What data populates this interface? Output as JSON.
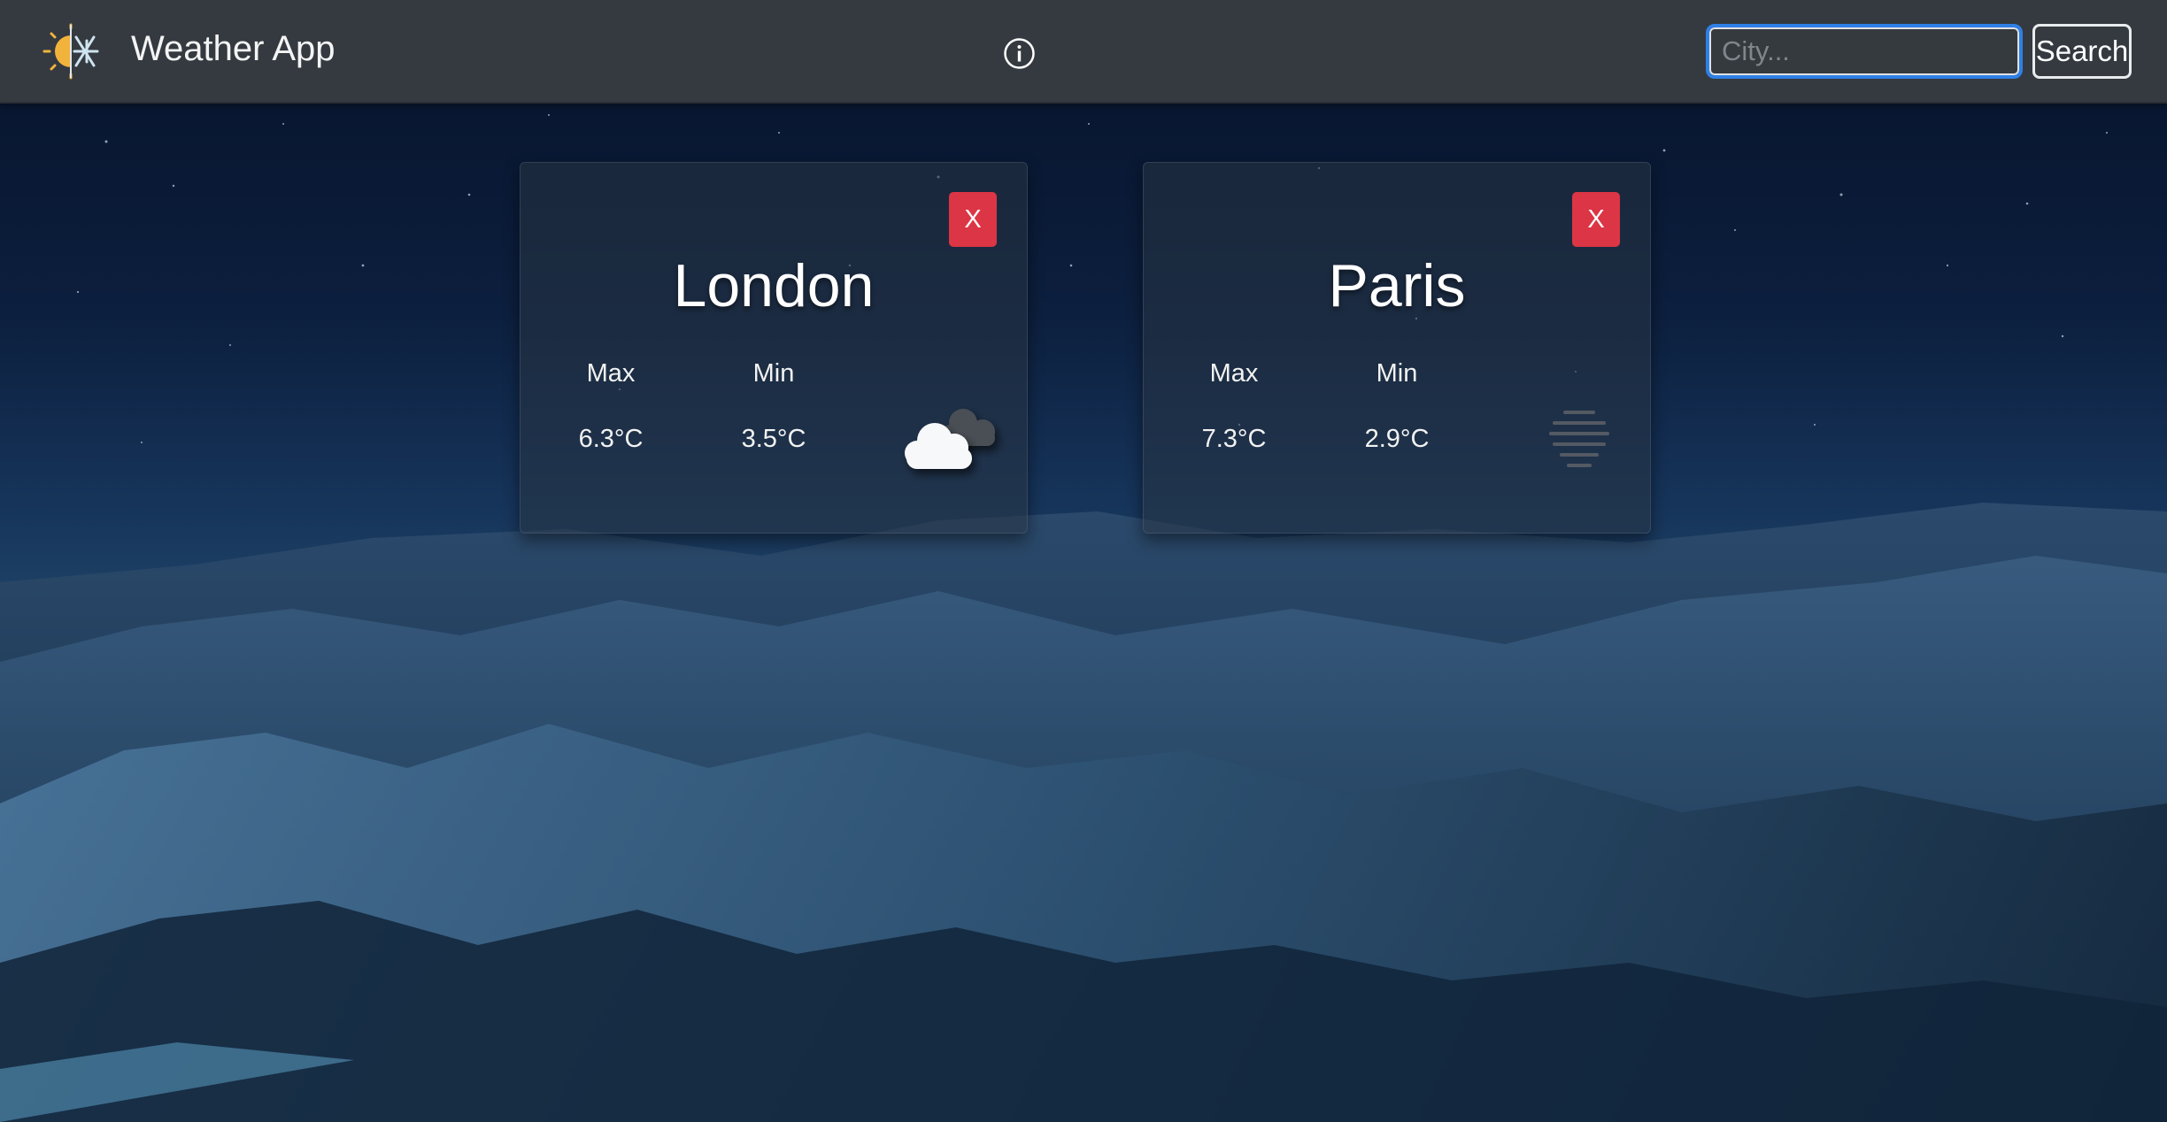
{
  "header": {
    "title": "Weather App",
    "logo_icon": "sun-snowflake-icon",
    "info_icon": "info-icon"
  },
  "search": {
    "placeholder": "City...",
    "value": "",
    "button_label": "Search"
  },
  "cards": [
    {
      "city": "London",
      "close_label": "X",
      "max_label": "Max",
      "min_label": "Min",
      "max_temp": "6.3°C",
      "min_temp": "3.5°C",
      "weather_icon": "cloudy-icon"
    },
    {
      "city": "Paris",
      "close_label": "X",
      "max_label": "Max",
      "min_label": "Min",
      "max_temp": "7.3°C",
      "min_temp": "2.9°C",
      "weather_icon": "mist-icon"
    }
  ],
  "colors": {
    "navbar": "#343a40",
    "close_button": "#dc3545",
    "search_focus": "#2f80e6"
  }
}
